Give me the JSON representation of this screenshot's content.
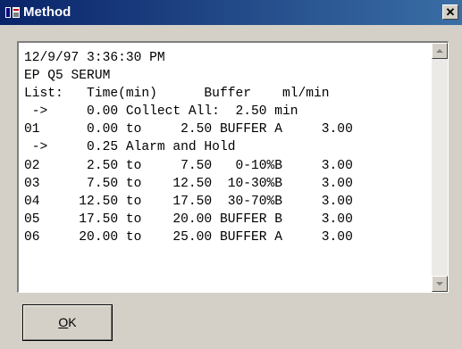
{
  "window": {
    "title": "Method",
    "close_glyph": "✕",
    "icon": "app-window-icon"
  },
  "content": {
    "lines": [
      "12/9/97 3:36:30 PM",
      "EP Q5 SERUM",
      "List:   Time(min)      Buffer    ml/min",
      " ->     0.00 Collect All:  2.50 min",
      "01      0.00 to     2.50 BUFFER A     3.00",
      " ->     0.25 Alarm and Hold",
      "02      2.50 to     7.50   0-10%B     3.00",
      "03      7.50 to    12.50  10-30%B     3.00",
      "04     12.50 to    17.50  30-70%B     3.00",
      "05     17.50 to    20.00 BUFFER B     3.00",
      "06     20.00 to    25.00 BUFFER A     3.00"
    ]
  },
  "ok_button": {
    "mnemonic": "O",
    "rest": "K"
  }
}
